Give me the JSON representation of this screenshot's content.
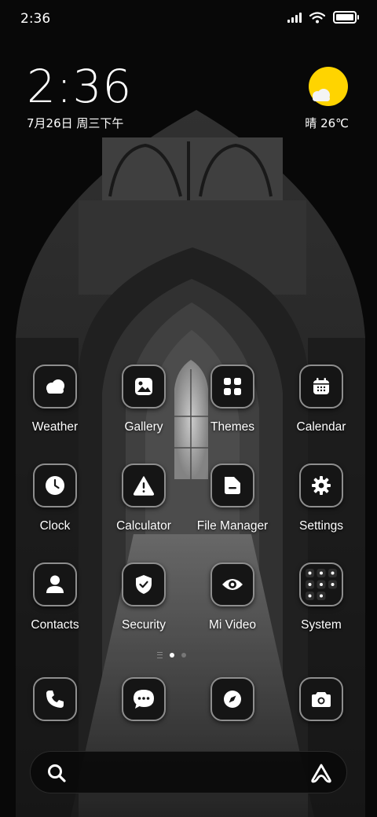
{
  "status_bar": {
    "time": "2:36"
  },
  "clock_widget": {
    "time": "2:36",
    "date": "7月26日 周三下午"
  },
  "weather_widget": {
    "summary": "晴 26℃",
    "icon": "sun-cloud-icon",
    "sun_color": "#FFD400"
  },
  "apps": [
    {
      "label": "Weather",
      "icon": "cloud-icon"
    },
    {
      "label": "Gallery",
      "icon": "image-icon"
    },
    {
      "label": "Themes",
      "icon": "grid-icon"
    },
    {
      "label": "Calendar",
      "icon": "calendar-icon"
    },
    {
      "label": "Clock",
      "icon": "clock-icon"
    },
    {
      "label": "Calculator",
      "icon": "warning-icon"
    },
    {
      "label": "File Manager",
      "icon": "folder-icon"
    },
    {
      "label": "Settings",
      "icon": "gear-icon"
    },
    {
      "label": "Contacts",
      "icon": "person-icon"
    },
    {
      "label": "Security",
      "icon": "shield-icon"
    },
    {
      "label": "Mi Video",
      "icon": "eye-icon"
    },
    {
      "label": "System",
      "icon": "folder-grid-icon"
    }
  ],
  "page_indicator": {
    "pages": 2,
    "current": 1
  },
  "dock": [
    {
      "icon": "phone-icon"
    },
    {
      "icon": "message-icon"
    },
    {
      "icon": "compass-icon"
    },
    {
      "icon": "camera-icon"
    }
  ],
  "search_bar": {
    "left_icon": "search-icon",
    "right_icon": "assistant-icon"
  }
}
